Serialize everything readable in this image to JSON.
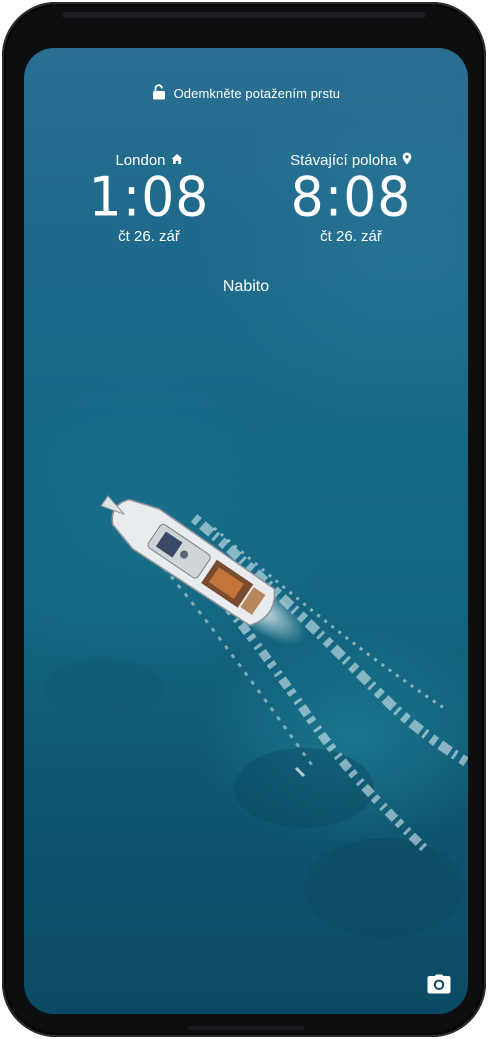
{
  "lock_screen": {
    "unlock_hint": "Odemkněte potažením prstu",
    "clocks": [
      {
        "city": "London",
        "city_icon": "home-icon",
        "time": "1:08",
        "date": "čt 26. zář"
      },
      {
        "city": "Stávající poloha",
        "city_icon": "location-pin-icon",
        "time": "8:08",
        "date": "čt 26. zář"
      }
    ],
    "charging_status": "Nabito",
    "shortcut_icon": "camera-icon"
  },
  "colors": {
    "ocean_top": "#2a6f91",
    "ocean_bottom": "#0b4a64",
    "text": "#ffffff",
    "frame": "#0d0e10"
  }
}
